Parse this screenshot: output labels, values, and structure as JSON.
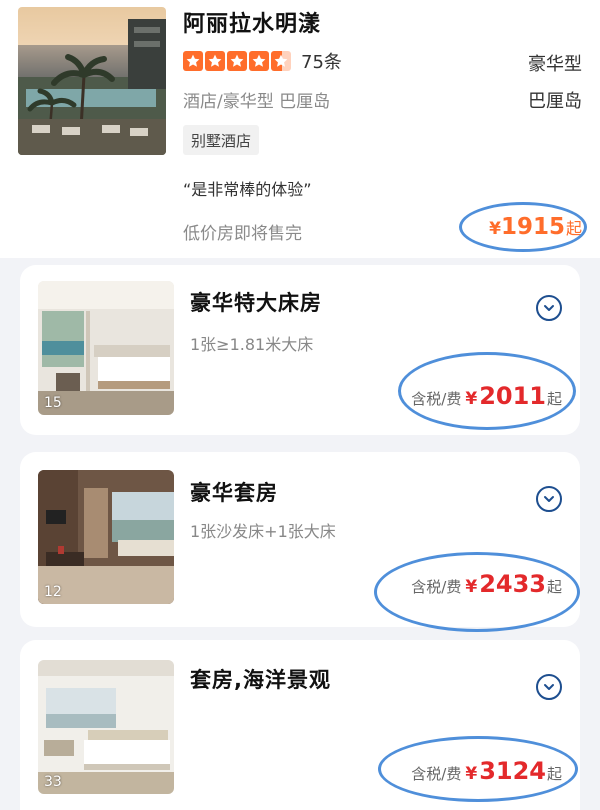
{
  "hotel": {
    "name": "阿丽拉水明漾",
    "rating_stars": 4.5,
    "review_count": "75条",
    "type_right": "豪华型",
    "subtitle": "酒店/豪华型  巴厘岛",
    "region_right": "巴厘岛",
    "tag": "别墅酒店",
    "quote": "“是非常棒的体验”",
    "low_price_note": "低价房即将售完",
    "price_symbol": "¥",
    "price": "1915",
    "price_suffix": "起"
  },
  "rooms": [
    {
      "name": "豪华特大床房",
      "bed": "1张≥1.81米大床",
      "photo_count": "15",
      "tax_label": "含税/费",
      "price_symbol": "¥",
      "price": "2011",
      "price_suffix": "起"
    },
    {
      "name": "豪华套房",
      "bed": "1张沙发床+1张大床",
      "photo_count": "12",
      "tax_label": "含税/费",
      "price_symbol": "¥",
      "price": "2433",
      "price_suffix": "起"
    },
    {
      "name": "套房,海洋景观",
      "bed": "",
      "photo_count": "33",
      "tax_label": "含税/费",
      "price_symbol": "¥",
      "price": "3124",
      "price_suffix": "起"
    }
  ],
  "icons": {
    "star": "star-icon",
    "expand": "chevron-down-icon"
  },
  "colors": {
    "accent_orange": "#ff6d2b",
    "price_red": "#e3292b",
    "expand_blue": "#1d4e8f",
    "annotation_blue": "#4f8fda"
  }
}
